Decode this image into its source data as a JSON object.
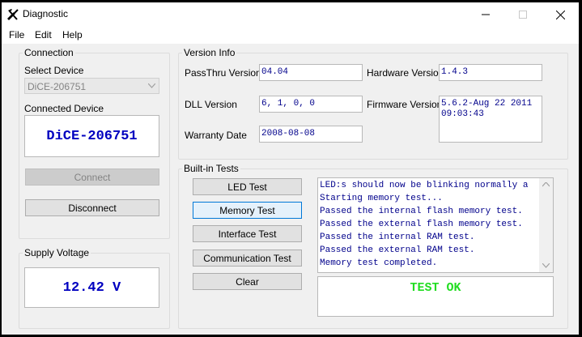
{
  "window": {
    "title": "Diagnostic"
  },
  "menu": {
    "items": [
      "File",
      "Edit",
      "Help"
    ]
  },
  "connection": {
    "group_label": "Connection",
    "select_device_label": "Select Device",
    "selected_device": "DiCE-206751",
    "connected_device_label": "Connected Device",
    "connected_device": "DiCE-206751",
    "connect_label": "Connect",
    "disconnect_label": "Disconnect"
  },
  "supply": {
    "group_label": "Supply Voltage",
    "value": "12.42 V"
  },
  "version": {
    "group_label": "Version Info",
    "passthru_label": "PassThru Version",
    "passthru": "04.04",
    "hardware_label": "Hardware Version",
    "hardware": "1.4.3",
    "dll_label": "DLL Version",
    "dll": "6, 1, 0, 0",
    "firmware_label": "Firmware Version",
    "firmware": "5.6.2-Aug 22 2011\n09:03:43",
    "warranty_label": "Warranty Date",
    "warranty": "2008-08-08"
  },
  "tests": {
    "group_label": "Built-in Tests",
    "buttons": [
      "LED Test",
      "Memory Test",
      "Interface Test",
      "Communication Test",
      "Clear"
    ],
    "log": [
      "LED:s should now be blinking normally a",
      "Starting memory test...",
      "Passed the internal flash memory test.",
      "Passed the external flash memory test.",
      "Passed the internal RAM test.",
      "Passed the external RAM test.",
      "Memory test completed."
    ],
    "result": "TEST OK",
    "result_color": "#22dd22"
  }
}
